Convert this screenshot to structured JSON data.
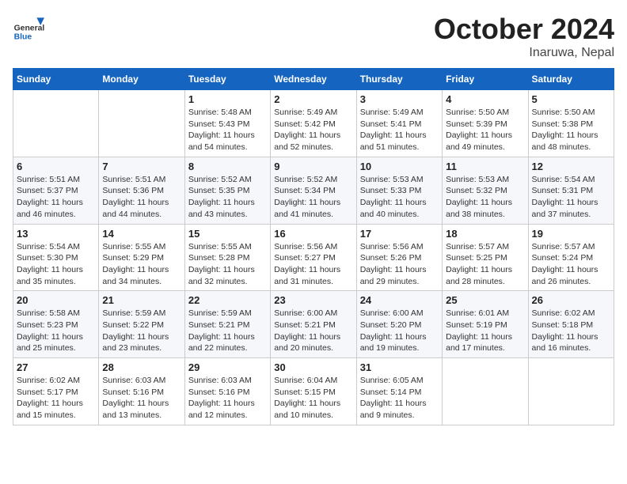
{
  "header": {
    "logo_general": "General",
    "logo_blue": "Blue",
    "month_title": "October 2024",
    "location": "Inaruwa, Nepal"
  },
  "days_of_week": [
    "Sunday",
    "Monday",
    "Tuesday",
    "Wednesday",
    "Thursday",
    "Friday",
    "Saturday"
  ],
  "weeks": [
    [
      {
        "day": "",
        "detail": ""
      },
      {
        "day": "",
        "detail": ""
      },
      {
        "day": "1",
        "detail": "Sunrise: 5:48 AM\nSunset: 5:43 PM\nDaylight: 11 hours\nand 54 minutes."
      },
      {
        "day": "2",
        "detail": "Sunrise: 5:49 AM\nSunset: 5:42 PM\nDaylight: 11 hours\nand 52 minutes."
      },
      {
        "day": "3",
        "detail": "Sunrise: 5:49 AM\nSunset: 5:41 PM\nDaylight: 11 hours\nand 51 minutes."
      },
      {
        "day": "4",
        "detail": "Sunrise: 5:50 AM\nSunset: 5:39 PM\nDaylight: 11 hours\nand 49 minutes."
      },
      {
        "day": "5",
        "detail": "Sunrise: 5:50 AM\nSunset: 5:38 PM\nDaylight: 11 hours\nand 48 minutes."
      }
    ],
    [
      {
        "day": "6",
        "detail": "Sunrise: 5:51 AM\nSunset: 5:37 PM\nDaylight: 11 hours\nand 46 minutes."
      },
      {
        "day": "7",
        "detail": "Sunrise: 5:51 AM\nSunset: 5:36 PM\nDaylight: 11 hours\nand 44 minutes."
      },
      {
        "day": "8",
        "detail": "Sunrise: 5:52 AM\nSunset: 5:35 PM\nDaylight: 11 hours\nand 43 minutes."
      },
      {
        "day": "9",
        "detail": "Sunrise: 5:52 AM\nSunset: 5:34 PM\nDaylight: 11 hours\nand 41 minutes."
      },
      {
        "day": "10",
        "detail": "Sunrise: 5:53 AM\nSunset: 5:33 PM\nDaylight: 11 hours\nand 40 minutes."
      },
      {
        "day": "11",
        "detail": "Sunrise: 5:53 AM\nSunset: 5:32 PM\nDaylight: 11 hours\nand 38 minutes."
      },
      {
        "day": "12",
        "detail": "Sunrise: 5:54 AM\nSunset: 5:31 PM\nDaylight: 11 hours\nand 37 minutes."
      }
    ],
    [
      {
        "day": "13",
        "detail": "Sunrise: 5:54 AM\nSunset: 5:30 PM\nDaylight: 11 hours\nand 35 minutes."
      },
      {
        "day": "14",
        "detail": "Sunrise: 5:55 AM\nSunset: 5:29 PM\nDaylight: 11 hours\nand 34 minutes."
      },
      {
        "day": "15",
        "detail": "Sunrise: 5:55 AM\nSunset: 5:28 PM\nDaylight: 11 hours\nand 32 minutes."
      },
      {
        "day": "16",
        "detail": "Sunrise: 5:56 AM\nSunset: 5:27 PM\nDaylight: 11 hours\nand 31 minutes."
      },
      {
        "day": "17",
        "detail": "Sunrise: 5:56 AM\nSunset: 5:26 PM\nDaylight: 11 hours\nand 29 minutes."
      },
      {
        "day": "18",
        "detail": "Sunrise: 5:57 AM\nSunset: 5:25 PM\nDaylight: 11 hours\nand 28 minutes."
      },
      {
        "day": "19",
        "detail": "Sunrise: 5:57 AM\nSunset: 5:24 PM\nDaylight: 11 hours\nand 26 minutes."
      }
    ],
    [
      {
        "day": "20",
        "detail": "Sunrise: 5:58 AM\nSunset: 5:23 PM\nDaylight: 11 hours\nand 25 minutes."
      },
      {
        "day": "21",
        "detail": "Sunrise: 5:59 AM\nSunset: 5:22 PM\nDaylight: 11 hours\nand 23 minutes."
      },
      {
        "day": "22",
        "detail": "Sunrise: 5:59 AM\nSunset: 5:21 PM\nDaylight: 11 hours\nand 22 minutes."
      },
      {
        "day": "23",
        "detail": "Sunrise: 6:00 AM\nSunset: 5:21 PM\nDaylight: 11 hours\nand 20 minutes."
      },
      {
        "day": "24",
        "detail": "Sunrise: 6:00 AM\nSunset: 5:20 PM\nDaylight: 11 hours\nand 19 minutes."
      },
      {
        "day": "25",
        "detail": "Sunrise: 6:01 AM\nSunset: 5:19 PM\nDaylight: 11 hours\nand 17 minutes."
      },
      {
        "day": "26",
        "detail": "Sunrise: 6:02 AM\nSunset: 5:18 PM\nDaylight: 11 hours\nand 16 minutes."
      }
    ],
    [
      {
        "day": "27",
        "detail": "Sunrise: 6:02 AM\nSunset: 5:17 PM\nDaylight: 11 hours\nand 15 minutes."
      },
      {
        "day": "28",
        "detail": "Sunrise: 6:03 AM\nSunset: 5:16 PM\nDaylight: 11 hours\nand 13 minutes."
      },
      {
        "day": "29",
        "detail": "Sunrise: 6:03 AM\nSunset: 5:16 PM\nDaylight: 11 hours\nand 12 minutes."
      },
      {
        "day": "30",
        "detail": "Sunrise: 6:04 AM\nSunset: 5:15 PM\nDaylight: 11 hours\nand 10 minutes."
      },
      {
        "day": "31",
        "detail": "Sunrise: 6:05 AM\nSunset: 5:14 PM\nDaylight: 11 hours\nand 9 minutes."
      },
      {
        "day": "",
        "detail": ""
      },
      {
        "day": "",
        "detail": ""
      }
    ]
  ]
}
